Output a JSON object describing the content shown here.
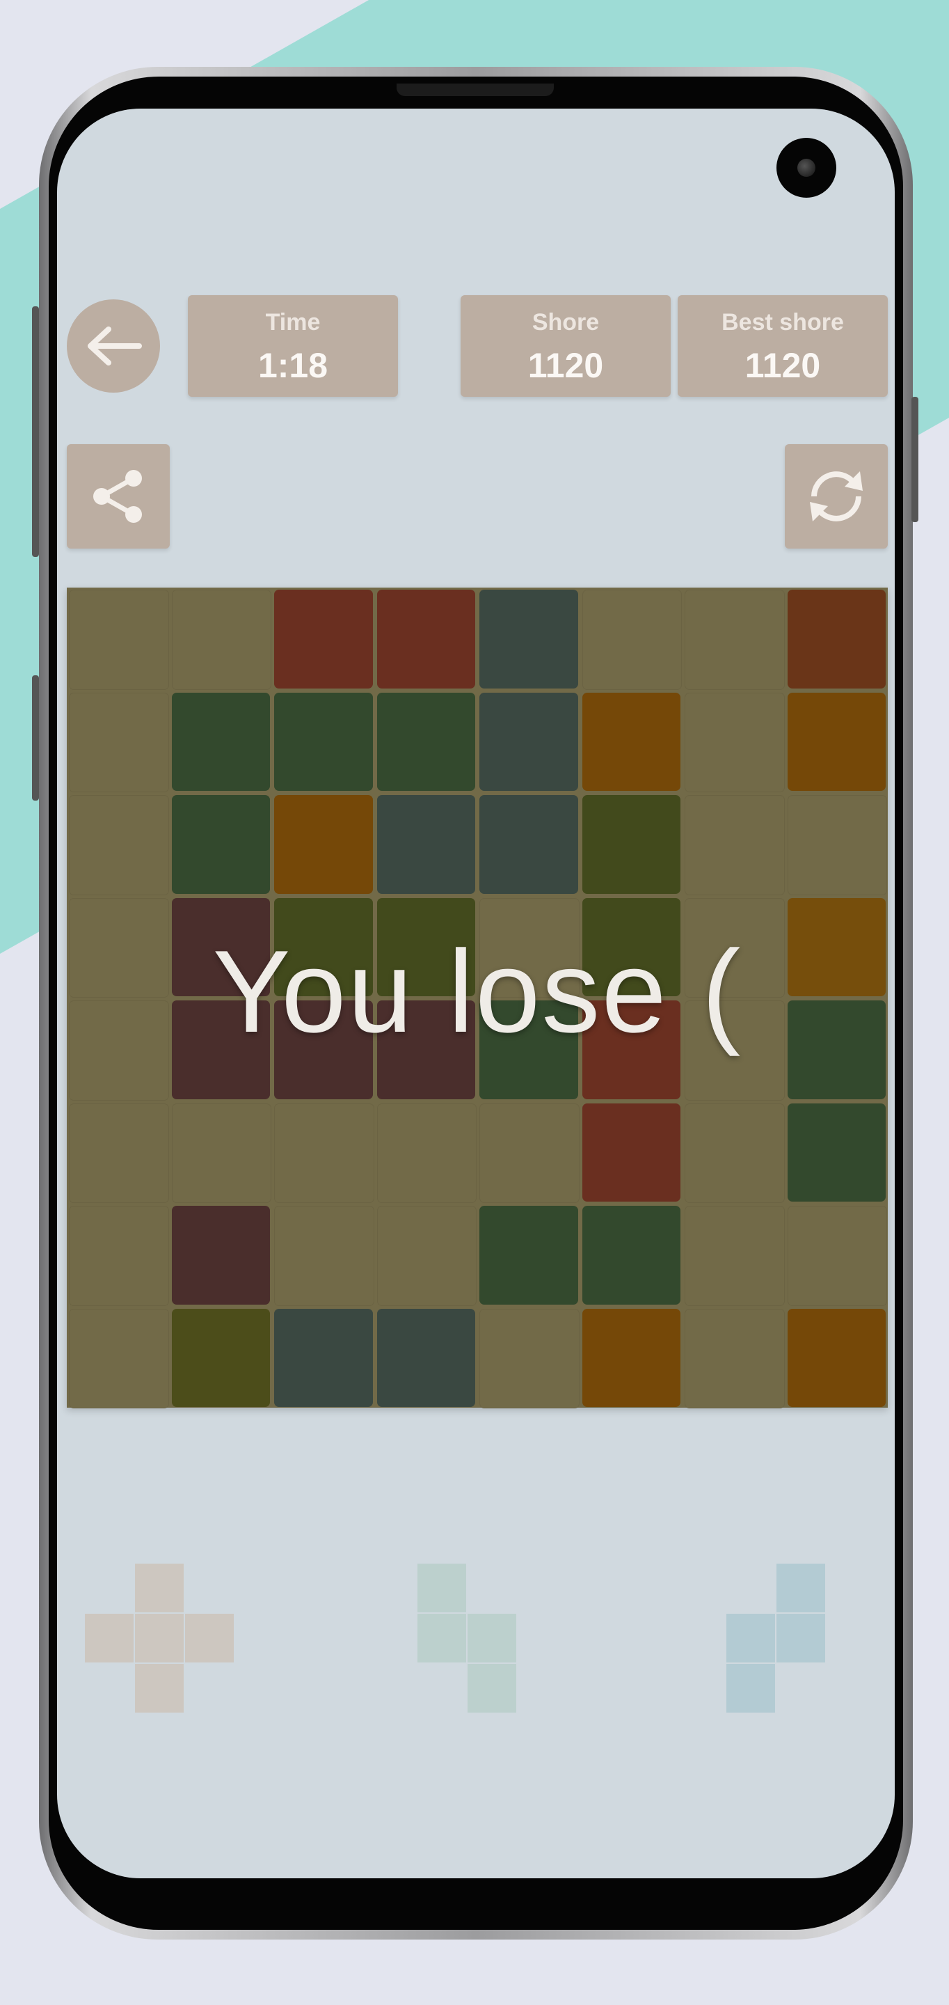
{
  "header": {
    "time_label": "Time",
    "time_value": "1:18",
    "score_label": "Shore",
    "score_value": "1120",
    "best_label": "Best shore",
    "best_value": "1120"
  },
  "icons": {
    "back": "arrow-left-icon",
    "share": "share-icon",
    "restart": "refresh-icon"
  },
  "message": "You lose (",
  "board": {
    "size": 8,
    "palette": {
      "e": "#726a48",
      "R": "#6a2f20",
      "RB": "#6a3518",
      "S": "#3a4841",
      "G": "#33492d",
      "O": "#754808",
      "OG": "#764e0c",
      "L": "#424a1c",
      "P": "#4a2e2c",
      "Y": "#4c4d1a"
    },
    "rows": [
      [
        "e",
        "e",
        "R",
        "R",
        "S",
        "e",
        "e",
        "RB"
      ],
      [
        "e",
        "G",
        "G",
        "G",
        "S",
        "O",
        "e",
        "O"
      ],
      [
        "e",
        "G",
        "O",
        "S",
        "S",
        "L",
        "e",
        "e"
      ],
      [
        "e",
        "P",
        "L",
        "L",
        "e",
        "L",
        "e",
        "OG"
      ],
      [
        "e",
        "P",
        "P",
        "P",
        "G",
        "R",
        "e",
        "G"
      ],
      [
        "e",
        "e",
        "e",
        "e",
        "e",
        "R",
        "e",
        "G"
      ],
      [
        "e",
        "P",
        "e",
        "e",
        "G",
        "G",
        "e",
        "e"
      ],
      [
        "e",
        "Y",
        "S",
        "S",
        "e",
        "O",
        "e",
        "O"
      ]
    ]
  },
  "pieces": [
    {
      "name": "plus-piece",
      "color": "#cdc7c0",
      "cells": [
        [
          1,
          0
        ],
        [
          0,
          1
        ],
        [
          1,
          1
        ],
        [
          2,
          1
        ],
        [
          1,
          2
        ]
      ]
    },
    {
      "name": "s-piece",
      "color": "#bcd0cd",
      "cells": [
        [
          0,
          0
        ],
        [
          0,
          1
        ],
        [
          1,
          1
        ],
        [
          1,
          2
        ]
      ]
    },
    {
      "name": "z-piece",
      "color": "#b3cbd3",
      "cells": [
        [
          1,
          0
        ],
        [
          0,
          1
        ],
        [
          1,
          1
        ],
        [
          0,
          2
        ]
      ]
    }
  ]
}
